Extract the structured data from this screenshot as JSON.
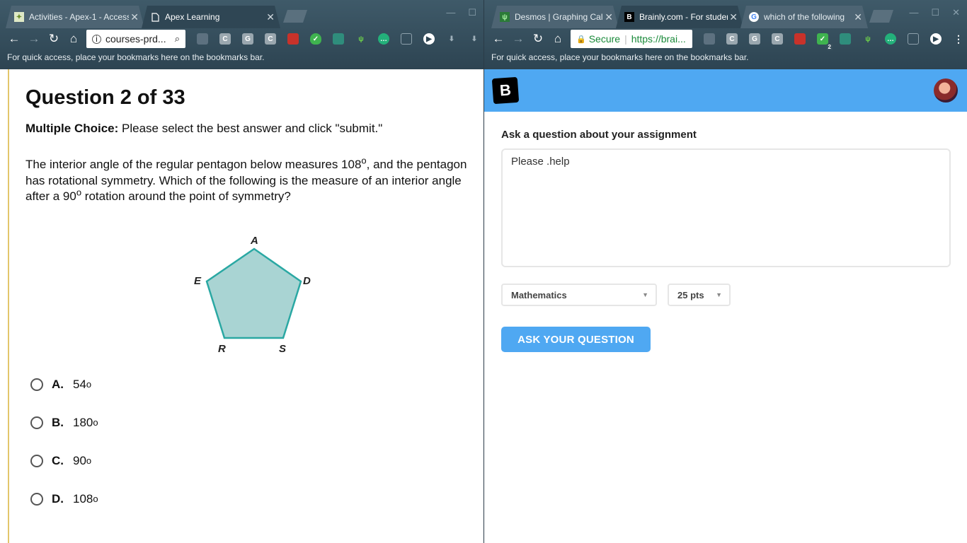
{
  "left_window": {
    "tabs": [
      {
        "label": "Activities - Apex-1 - Access",
        "active": false
      },
      {
        "label": "Apex Learning",
        "active": true
      }
    ],
    "address": "courses-prd...",
    "bookmarks_hint": "For quick access, place your bookmarks here on the bookmarks bar.",
    "extensions": [
      "C",
      "G",
      "C"
    ]
  },
  "right_window": {
    "tabs": [
      {
        "label": "Desmos | Graphing Calculator",
        "active": false
      },
      {
        "label": "Brainly.com - For students",
        "active": true
      },
      {
        "label": "which of the following",
        "active": false
      }
    ],
    "secure_label": "Secure",
    "address": "https://brai...",
    "bookmarks_hint": "For quick access, place your bookmarks here on the bookmarks bar.",
    "extensions": [
      "C",
      "G",
      "C"
    ],
    "badge": "2"
  },
  "apex": {
    "title": "Question 2 of 33",
    "instruction_bold": "Multiple Choice:",
    "instruction_rest": " Please select the best answer and click \"submit.\"",
    "question_part1": "The interior angle of the regular pentagon below measures 108",
    "question_part2": ", and the pentagon has rotational symmetry. Which of the following is the measure of an interior angle after a 90",
    "question_part3": " rotation around the point of symmetry?",
    "degree_symbol": "o",
    "pentagon_labels": {
      "a": "A",
      "d": "D",
      "s": "S",
      "r": "R",
      "e": "E"
    },
    "pentagon_fill": "#a9d4d3",
    "pentagon_stroke": "#2aa8a3",
    "choices": [
      {
        "letter": "A.",
        "value": "54"
      },
      {
        "letter": "B.",
        "value": "180"
      },
      {
        "letter": "C.",
        "value": "90"
      },
      {
        "letter": "D.",
        "value": "108"
      }
    ]
  },
  "brainly": {
    "logo": "B",
    "ask_label": "Ask a question about your assignment",
    "question_value": "Please .help",
    "subject": "Mathematics",
    "points": "25 pts",
    "ask_button": "ASK YOUR QUESTION",
    "accent_color": "#4fa8f2"
  }
}
